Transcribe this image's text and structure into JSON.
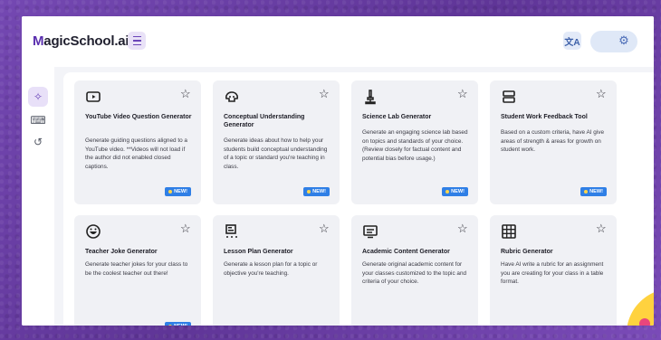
{
  "app": {
    "logo_prefix": "M",
    "logo_text": "agicSchool.ai"
  },
  "header": {
    "translate_icon": "translate-icon",
    "settings_icon": "gear-icon"
  },
  "sidebar": {
    "items": [
      {
        "icon": "sparkle-icon",
        "active": true
      },
      {
        "icon": "chat-icon",
        "active": false
      },
      {
        "icon": "history-icon",
        "active": false
      }
    ]
  },
  "badge_label": "NEW!",
  "cards": [
    {
      "icon": "youtube-icon",
      "title": "YouTube Video Question Generator",
      "desc": "Generate guiding questions aligned to a YouTube video. **Videos will not load if the author did not enabled closed captions.",
      "new": true
    },
    {
      "icon": "brain-icon",
      "title": "Conceptual Understanding Generator",
      "desc": "Generate ideas about how to help your students build conceptual understanding of a topic or standard you're teaching in class.",
      "new": true
    },
    {
      "icon": "microscope-icon",
      "title": "Science Lab Generator",
      "desc": "Generate an engaging science lab based on topics and standards of your choice. (Review closely for factual content and potential bias before usage.)",
      "new": true
    },
    {
      "icon": "feedback-icon",
      "title": "Student Work Feedback Tool",
      "desc": "Based on a custom criteria, have AI give areas of strength & areas for growth on student work.",
      "new": true
    },
    {
      "icon": "laugh-icon",
      "title": "Teacher Joke Generator",
      "desc": "Generate teacher jokes for your class to be the coolest teacher out there!",
      "new": true
    },
    {
      "icon": "lesson-plan-icon",
      "title": "Lesson Plan Generator",
      "desc": "Generate a lesson plan for a topic or objective you're teaching.",
      "new": false
    },
    {
      "icon": "monitor-icon",
      "title": "Academic Content Generator",
      "desc": "Generate original academic content for your classes customized to the topic and criteria of your choice.",
      "new": false
    },
    {
      "icon": "grid-icon",
      "title": "Rubric Generator",
      "desc": "Have AI write a rubric for an assignment you are creating for your class in a table format.",
      "new": false
    }
  ]
}
